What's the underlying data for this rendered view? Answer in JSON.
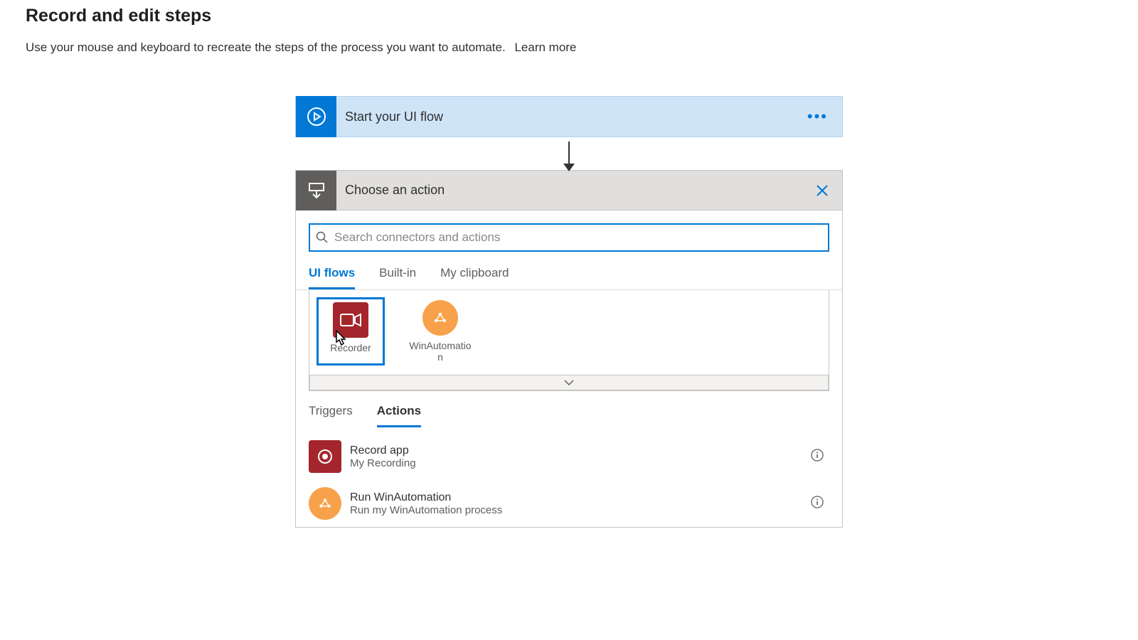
{
  "header": {
    "title": "Record and edit steps",
    "subtitle": "Use your mouse and keyboard to recreate the steps of the process you want to automate.",
    "learn_more": "Learn more"
  },
  "start_card": {
    "title": "Start your UI flow"
  },
  "choose_action": {
    "title": "Choose an action",
    "search_placeholder": "Search connectors and actions",
    "tabs": [
      "UI flows",
      "Built-in",
      "My clipboard"
    ],
    "active_tab": "UI flows",
    "connectors": [
      {
        "name": "Recorder",
        "icon": "recorder",
        "selected": true
      },
      {
        "name": "WinAutomation",
        "icon": "winauto",
        "selected": false
      }
    ],
    "sub_tabs": [
      "Triggers",
      "Actions"
    ],
    "active_sub_tab": "Actions",
    "actions": [
      {
        "title": "Record app",
        "sub": "My Recording",
        "icon": "record"
      },
      {
        "title": "Run WinAutomation",
        "sub": "Run my WinAutomation process",
        "icon": "winauto"
      }
    ]
  }
}
